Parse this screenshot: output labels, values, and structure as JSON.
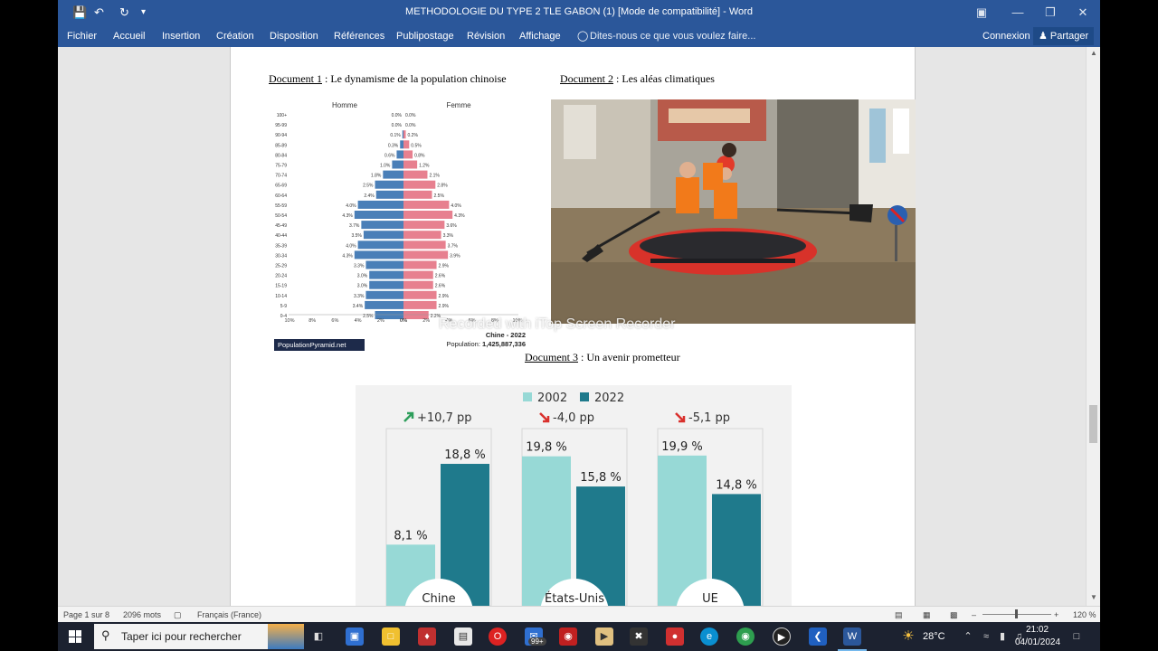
{
  "window": {
    "title": "METHODOLOGIE DU TYPE 2 TLE GABON (1) [Mode de compatibilité] - Word"
  },
  "ribbon": {
    "tabs": [
      "Fichier",
      "Accueil",
      "Insertion",
      "Création",
      "Disposition",
      "Références",
      "Publipostage",
      "Révision",
      "Affichage"
    ],
    "tell_me": "Dites-nous ce que vous voulez faire...",
    "signin": "Connexion",
    "share": "Partager"
  },
  "doc1": {
    "label": "Document 1",
    "text": " : Le dynamisme de la population chinoise"
  },
  "doc2": {
    "label": "Document 2",
    "text": " : Les aléas climatiques"
  },
  "doc3": {
    "label": "Document 3",
    "text": " : Un avenir prometteur"
  },
  "watermark": "Recorded with iTop Screen Recorder",
  "chart_data": [
    {
      "type": "bar",
      "orientation": "horizontal-pyramid",
      "legend": [
        "Homme",
        "Femme"
      ],
      "categories": [
        "100+",
        "95-99",
        "90-94",
        "85-89",
        "80-84",
        "75-79",
        "70-74",
        "65-69",
        "60-64",
        "55-59",
        "50-54",
        "45-49",
        "40-44",
        "35-39",
        "30-34",
        "25-29",
        "20-24",
        "15-19",
        "10-14",
        "5-9",
        "0-4"
      ],
      "series": [
        {
          "name": "Homme",
          "values": [
            0.0,
            0.0,
            0.1,
            0.3,
            0.6,
            1.0,
            1.8,
            2.5,
            2.4,
            4.0,
            4.3,
            3.7,
            3.5,
            4.0,
            4.3,
            3.3,
            3.0,
            3.0,
            3.3,
            3.4,
            2.5
          ],
          "color": "#4a7fb8"
        },
        {
          "name": "Femme",
          "values": [
            0.0,
            0.0,
            0.2,
            0.5,
            0.8,
            1.2,
            2.1,
            2.8,
            2.5,
            4.0,
            4.3,
            3.6,
            3.3,
            3.7,
            3.9,
            2.9,
            2.6,
            2.6,
            2.9,
            2.9,
            2.2
          ],
          "color": "#e7808f"
        }
      ],
      "xticks": [
        "10%",
        "8%",
        "6%",
        "4%",
        "2%",
        "0%",
        "0%",
        "2%",
        "4%",
        "6%",
        "8%",
        "10%"
      ],
      "xlim": [
        10,
        10
      ],
      "title": "Chine - 2022",
      "population_label": "Population:",
      "population_value": "1,425,887,336",
      "source_badge": "PopulationPyramid.net"
    },
    {
      "type": "bar",
      "categories": [
        "Chine",
        "États-Unis",
        "UE"
      ],
      "series": [
        {
          "name": "2002",
          "values": [
            8.1,
            19.8,
            19.9
          ],
          "labels": [
            "8,1 %",
            "19,8 %",
            "19,9 %"
          ],
          "color": "#97d9d6"
        },
        {
          "name": "2022",
          "values": [
            18.8,
            15.8,
            14.8
          ],
          "labels": [
            "18,8 %",
            "15,8 %",
            "14,8 %"
          ],
          "color": "#1f7a8c"
        }
      ],
      "changes": [
        {
          "text": "+10,7 pp",
          "direction": "up",
          "color": "#2e9e5b"
        },
        {
          "text": "-4,0 pp",
          "direction": "down",
          "color": "#d9302c"
        },
        {
          "text": "-5,1 pp",
          "direction": "down",
          "color": "#d9302c"
        }
      ],
      "ylim": [
        0,
        25
      ]
    }
  ],
  "status": {
    "page": "Page 1 sur 8",
    "words": "2096 mots",
    "language": "Français (France)",
    "zoom": "120 %"
  },
  "taskbar": {
    "search_placeholder": "Taper ici pour rechercher",
    "badge": "99+",
    "temperature": "28°C",
    "time": "21:02",
    "date": "04/01/2024"
  }
}
